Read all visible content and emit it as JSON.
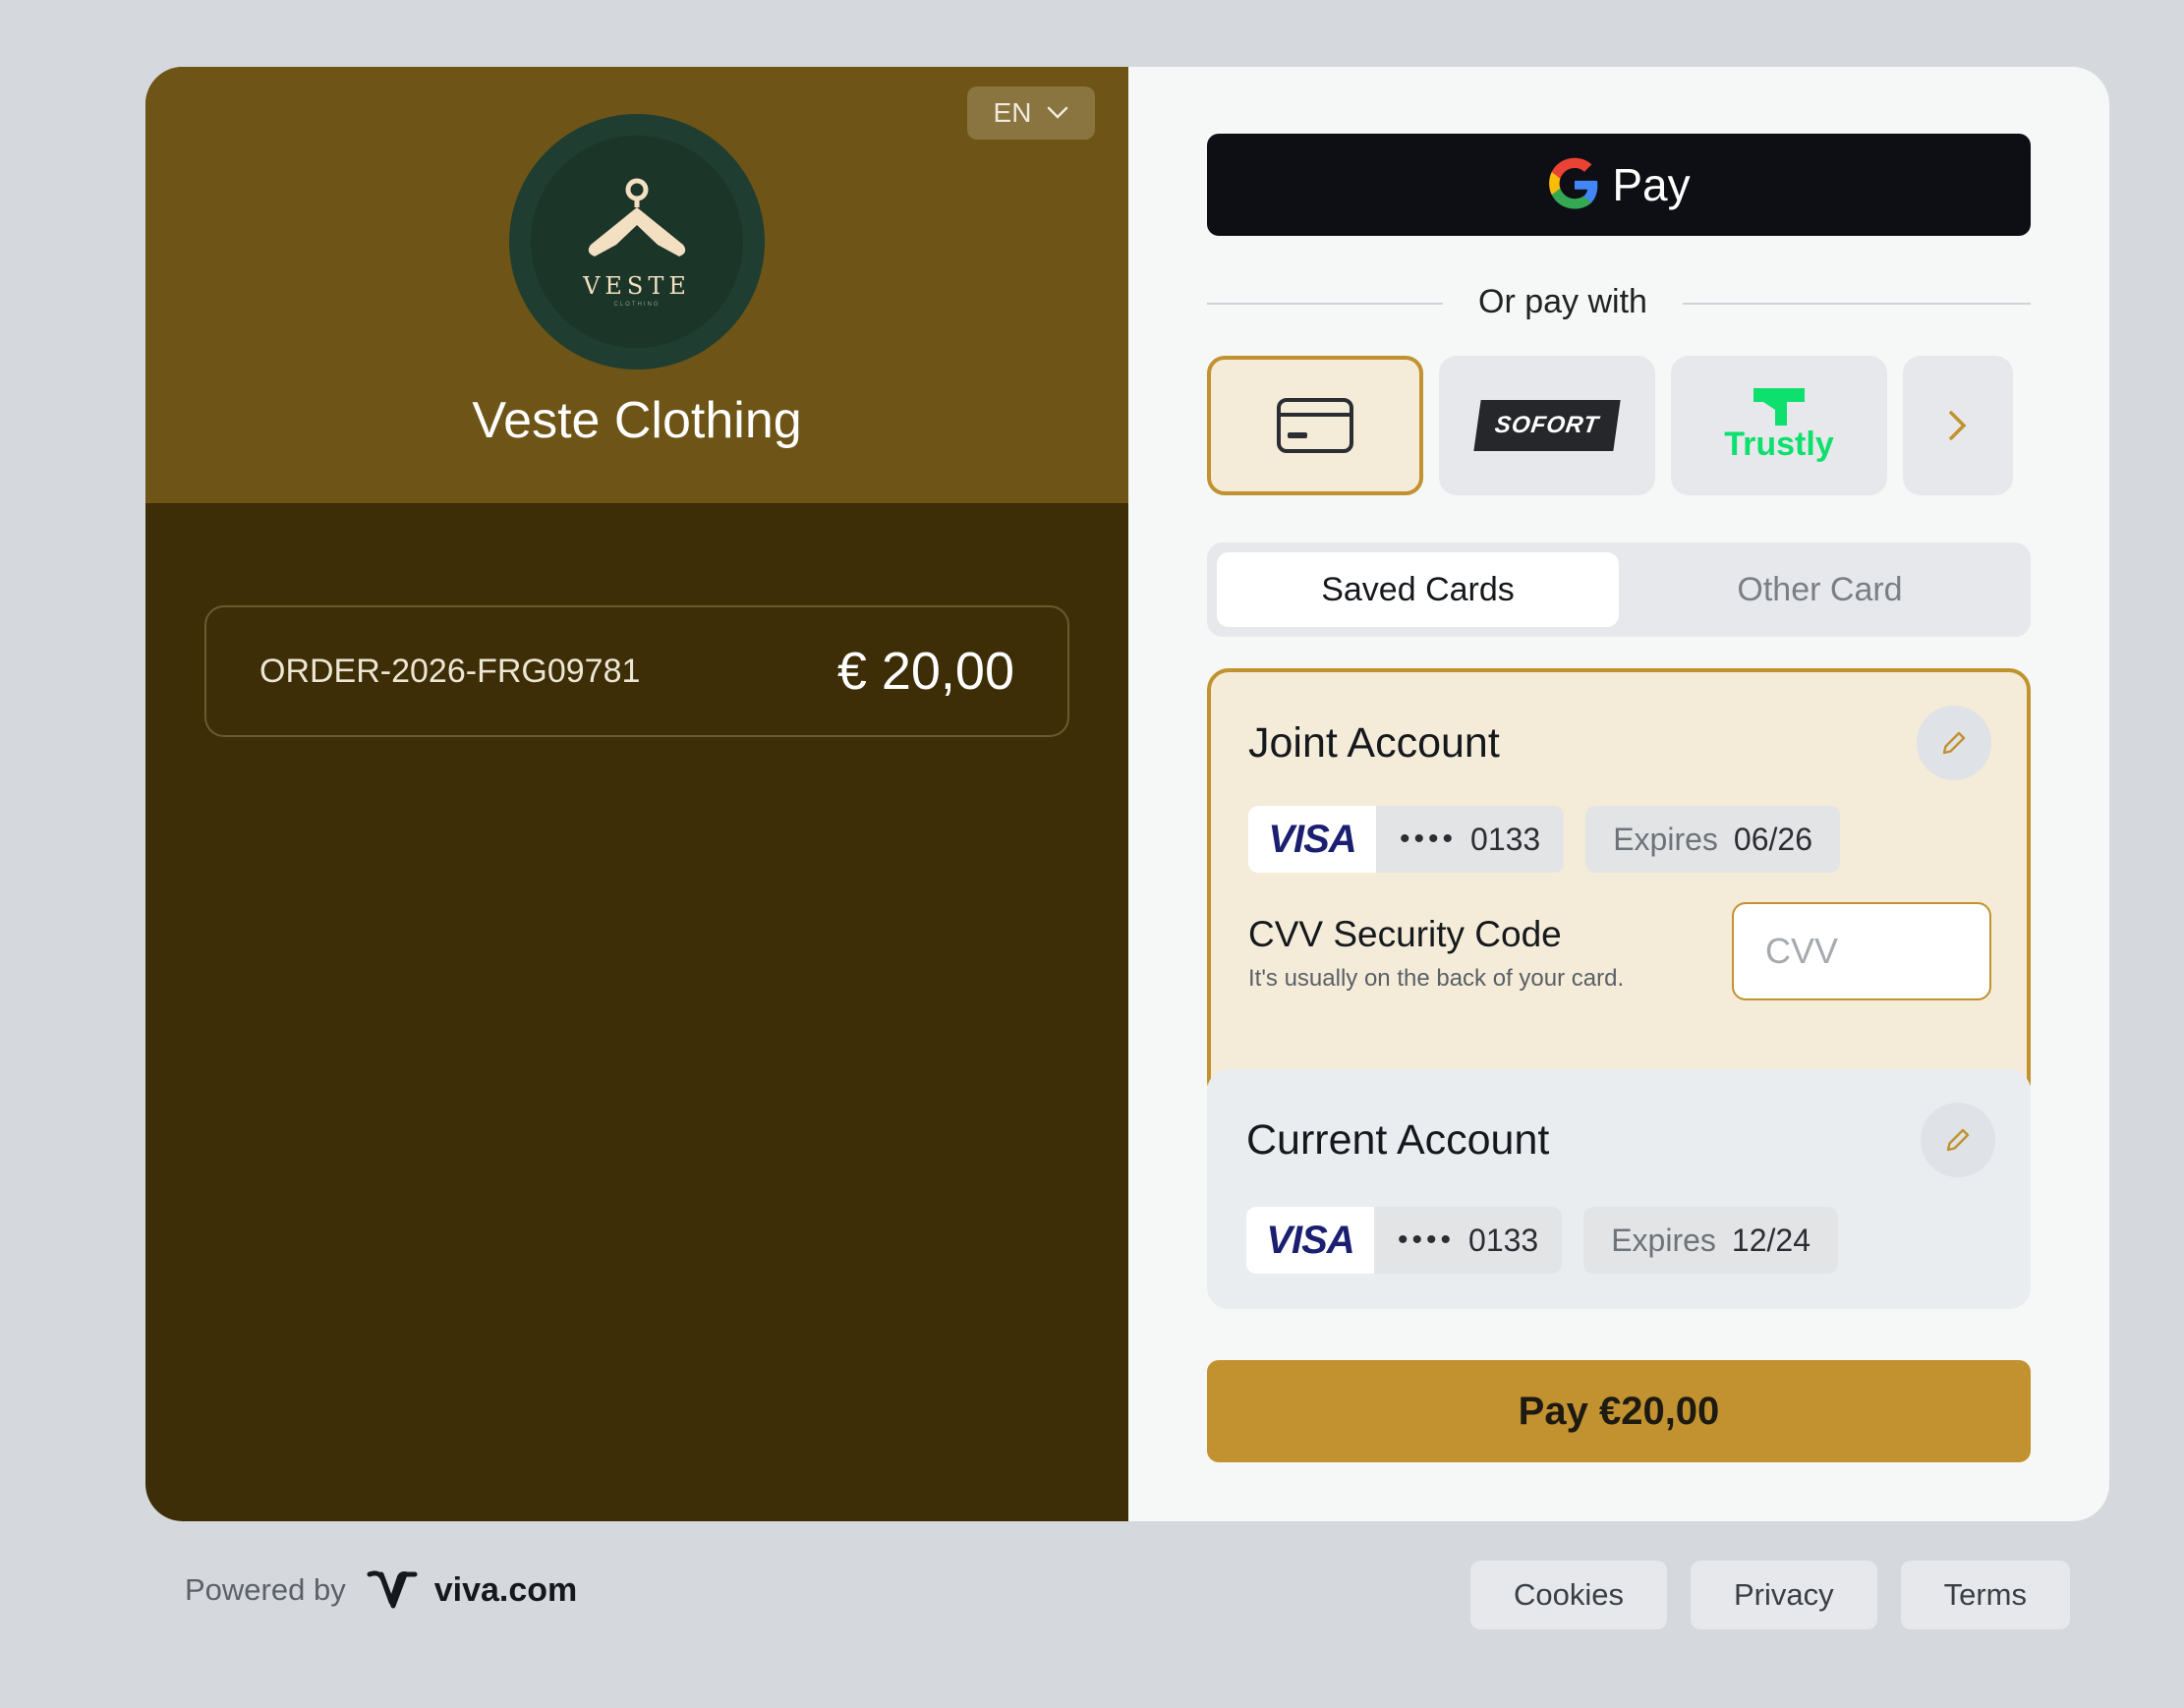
{
  "merchant": {
    "name": "Veste Clothing",
    "logo_text": "VESTE",
    "logo_subtext": "CLOTHING"
  },
  "language": {
    "selected": "EN"
  },
  "order": {
    "id": "ORDER-2026-FRG09781",
    "amount": "€ 20,00"
  },
  "wallet": {
    "label": "Pay"
  },
  "divider": {
    "text": "Or pay with"
  },
  "methods": [
    {
      "name": "card",
      "icon": "credit-card-icon"
    },
    {
      "name": "SOFORT"
    },
    {
      "name": "Trustly"
    },
    {
      "name": "more",
      "icon": "chevron-right-icon"
    }
  ],
  "tabs": [
    {
      "label": "Saved Cards"
    },
    {
      "label": "Other Card"
    }
  ],
  "saved_cards": [
    {
      "name": "Joint Account",
      "brand": "VISA",
      "dots": "••••",
      "last4": "0133",
      "expires_label": "Expires",
      "expires": "06/26"
    },
    {
      "name": "Current Account",
      "brand": "VISA",
      "dots": "••••",
      "last4": "0133",
      "expires_label": "Expires",
      "expires": "12/24"
    }
  ],
  "cvv": {
    "title": "CVV Security Code",
    "hint": "It's usually on the back of your card.",
    "placeholder": "CVV",
    "value": ""
  },
  "pay_button": {
    "label": "Pay €20,00"
  },
  "footer": {
    "powered_by": "Powered by",
    "brand": "viva.com",
    "links": [
      {
        "label": "Cookies"
      },
      {
        "label": "Privacy"
      },
      {
        "label": "Terms"
      }
    ]
  },
  "colors": {
    "accent": "#c1922f",
    "merchant_top": "#6e5517",
    "merchant_bottom": "#3d2e08",
    "trustly": "#0ee06e"
  }
}
